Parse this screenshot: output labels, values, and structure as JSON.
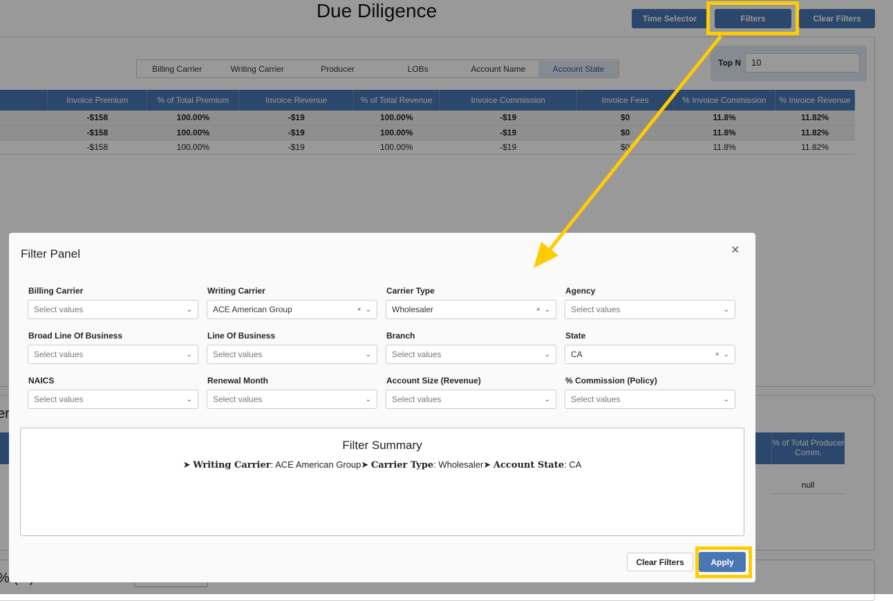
{
  "header": {
    "title": "Due Diligence",
    "buttons": [
      "Time Selector",
      "Filters",
      "Clear Filters"
    ]
  },
  "tabs": [
    "Billing Carrier",
    "Writing Carrier",
    "Producer",
    "LOBs",
    "Account Name",
    "Account State"
  ],
  "top_n": {
    "label": "Top N",
    "value": "10"
  },
  "table": {
    "columns": [
      "Invoice Premium",
      "% of Total Premium",
      "Invoice Revenue",
      "% of Total Revenue",
      "Invoice Commission",
      "Invoice Fees",
      "% Invoice Commission",
      "% Invoice Revenue"
    ],
    "rows": [
      [
        "-$158",
        "100.00%",
        "-$19",
        "100.00%",
        "-$19",
        "$0",
        "11.8%",
        "11.82%"
      ],
      [
        "-$158",
        "100.00%",
        "-$19",
        "100.00%",
        "-$19",
        "$0",
        "11.8%",
        "11.82%"
      ],
      [
        "-$158",
        "100.00%",
        "-$19",
        "100.00%",
        "-$19",
        "$0",
        "11.8%",
        "11.82%"
      ]
    ]
  },
  "second": {
    "partial_title": "er",
    "column": "% of Total Producer Comm.",
    "null_value": "null"
  },
  "third": {
    "partial_title": "% (...)"
  },
  "modal": {
    "title": "Filter Panel",
    "filters": [
      {
        "label": "Billing Carrier",
        "value": "",
        "placeholder": "Select values"
      },
      {
        "label": "Writing Carrier",
        "value": "ACE American Group",
        "placeholder": "Select values"
      },
      {
        "label": "Carrier Type",
        "value": "Wholesaler",
        "placeholder": "Select values"
      },
      {
        "label": "Agency",
        "value": "",
        "placeholder": "Select values"
      },
      {
        "label": "Broad Line Of Business",
        "value": "",
        "placeholder": "Select values"
      },
      {
        "label": "Line Of Business",
        "value": "",
        "placeholder": "Select values"
      },
      {
        "label": "Branch",
        "value": "",
        "placeholder": "Select values"
      },
      {
        "label": "State",
        "value": "CA",
        "placeholder": "Select values"
      },
      {
        "label": "NAICS",
        "value": "",
        "placeholder": "Select values"
      },
      {
        "label": "Renewal Month",
        "value": "",
        "placeholder": "Select values"
      },
      {
        "label": "Account Size (Revenue)",
        "value": "",
        "placeholder": "Select values"
      },
      {
        "label": "% Commission (Policy)",
        "value": "",
        "placeholder": "Select values"
      }
    ],
    "summary": {
      "title": "Filter Summary",
      "items": [
        {
          "key": "Writing Carrier",
          "value": "ACE American Group"
        },
        {
          "key": "Carrier Type",
          "value": "Wholesaler"
        },
        {
          "key": "Account State",
          "value": "CA"
        }
      ]
    },
    "clear_label": "Clear Filters",
    "apply_label": "Apply"
  },
  "colors": {
    "accent": "#4a77b4",
    "highlight": "#ffcc00"
  }
}
